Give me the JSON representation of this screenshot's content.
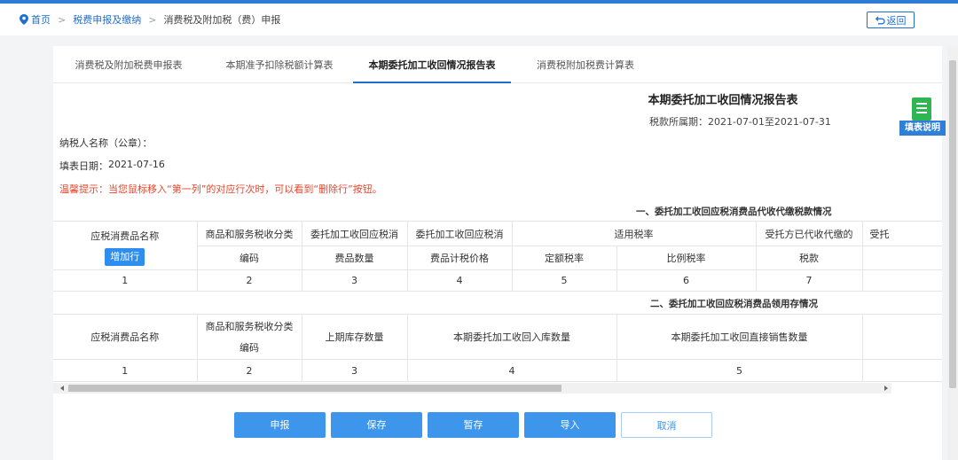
{
  "breadcrumb": {
    "home": "首页",
    "level2": "税费申报及缴纳",
    "current": "消费税及附加税（费）申报"
  },
  "back_label": "返回",
  "tabs": [
    {
      "label": "消费税及附加税费申报表",
      "active": false
    },
    {
      "label": "本期准予扣除税额计算表",
      "active": false
    },
    {
      "label": "本期委托加工收回情况报告表",
      "active": true
    },
    {
      "label": "消费税附加税费计算表",
      "active": false
    }
  ],
  "report": {
    "title": "本期委托加工收回情况报告表",
    "period_label": "税款所属期：",
    "period_value": "2021-07-01至2021-07-31",
    "taxpayer_label": "纳税人名称（公章）：",
    "taxpayer_value": "",
    "fill_date_label": "填表日期：",
    "fill_date_value": "2021-07-16",
    "tip": "温馨提示：当您鼠标移入“第一列”的对应行次时，可以看到“删除行”按钮。"
  },
  "section1": {
    "title": "一、委托加工收回应税消费品代收代缴税款情况",
    "add_button": "增加行",
    "headers": {
      "col1": "应税消费品名称",
      "col2_line1": "商品和服务税收分类",
      "col2_line2": "编码",
      "col3_line1": "委托加工收回应税消",
      "col3_line2": "费品数量",
      "col4_line1": "委托加工收回应税消",
      "col4_line2": "费品计税价格",
      "rate_group": "适用税率",
      "col5": "定额税率",
      "col6": "比例税率",
      "col7_line1": "受托方已代收代缴的",
      "col7_line2": "税款",
      "col8_partial": "受托"
    },
    "row_numbers": [
      "1",
      "2",
      "3",
      "4",
      "5",
      "6",
      "7"
    ]
  },
  "section2": {
    "title": "二、委托加工收回应税消费品领用存情况",
    "headers": {
      "col1": "应税消费品名称",
      "col2_line1": "商品和服务税收分类",
      "col2_line2": "编码",
      "col3": "上期库存数量",
      "col4": "本期委托加工收回入库数量",
      "col5": "本期委托加工收回直接销售数量"
    },
    "row_numbers": [
      "1",
      "2",
      "3",
      "4",
      "5"
    ]
  },
  "actions": {
    "submit": "申报",
    "save": "保存",
    "draft": "暂存",
    "import": "导入",
    "cancel": "取消"
  },
  "fill_guide_label": "填表说明",
  "colors": {
    "primary": "#2e8ef0",
    "link": "#1f6fd1",
    "warning": "#e8462e",
    "guide_icon": "#2fb552"
  }
}
